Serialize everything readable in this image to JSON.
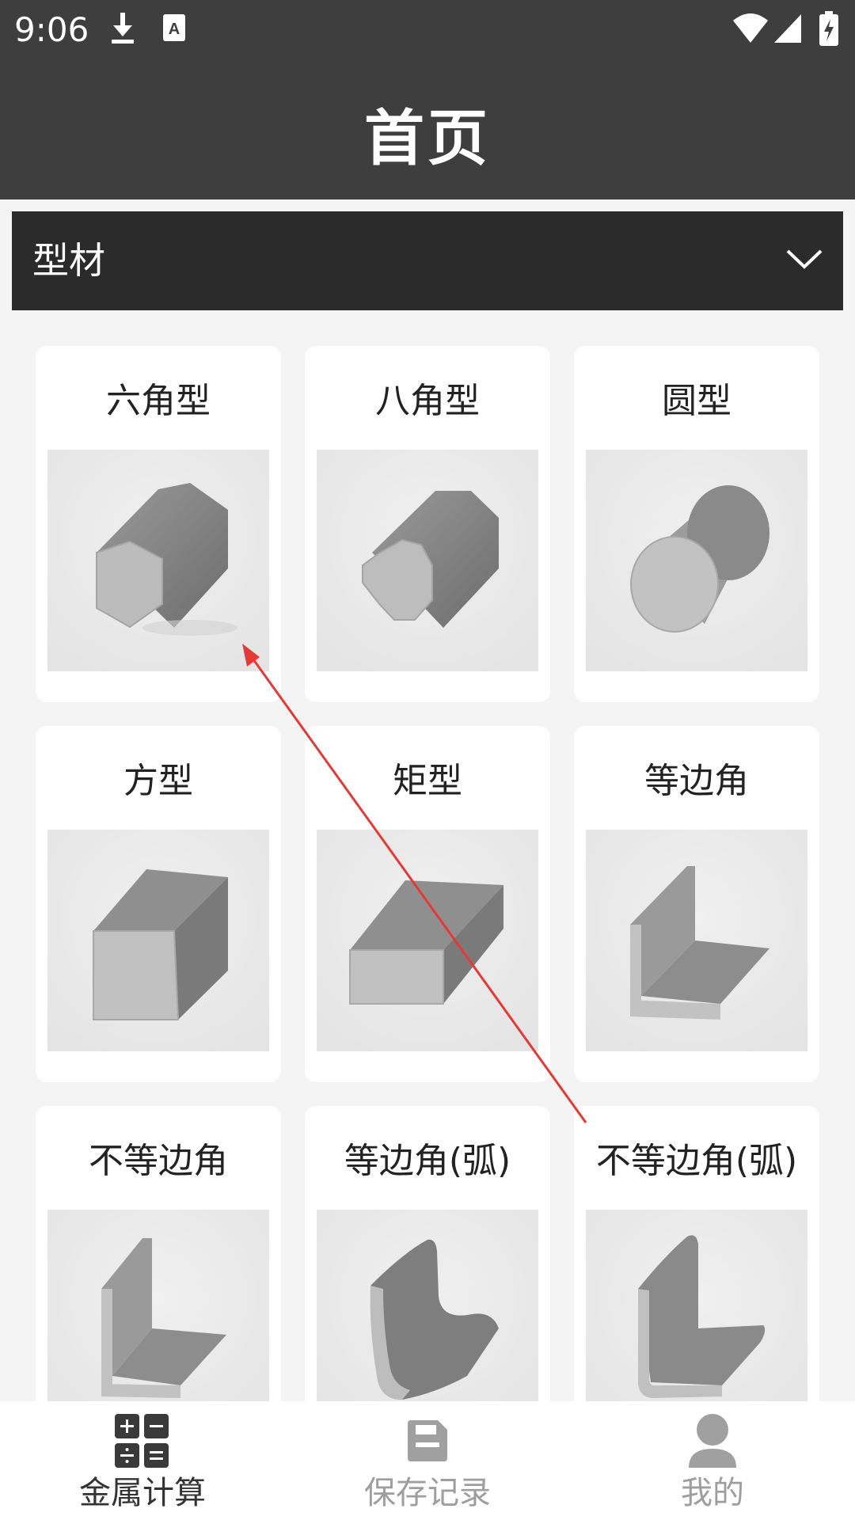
{
  "status_bar": {
    "time": "9:06",
    "icons": [
      "download-icon",
      "keyboard-a-icon",
      "wifi-icon",
      "signal-icon",
      "battery-icon"
    ]
  },
  "header": {
    "title": "首页"
  },
  "category": {
    "selected": "型材",
    "icon": "chevron-down-icon"
  },
  "grid": {
    "items": [
      {
        "label": "六角型",
        "icon": "hexagon-bar-icon"
      },
      {
        "label": "八角型",
        "icon": "octagon-bar-icon"
      },
      {
        "label": "圆型",
        "icon": "round-bar-icon"
      },
      {
        "label": "方型",
        "icon": "square-bar-icon"
      },
      {
        "label": "矩型",
        "icon": "rectangle-bar-icon"
      },
      {
        "label": "等边角",
        "icon": "equal-angle-icon"
      },
      {
        "label": "不等边角",
        "icon": "unequal-angle-icon"
      },
      {
        "label": "等边角(弧)",
        "icon": "equal-angle-arc-icon"
      },
      {
        "label": "不等边角(弧)",
        "icon": "unequal-angle-arc-icon"
      }
    ]
  },
  "bottom_nav": {
    "items": [
      {
        "label": "金属计算",
        "icon": "calculator-icon",
        "active": true
      },
      {
        "label": "保存记录",
        "icon": "save-icon",
        "active": false
      },
      {
        "label": "我的",
        "icon": "user-icon",
        "active": false
      }
    ]
  },
  "colors": {
    "header_bg": "#3e3e3e",
    "category_bg": "#2b2b2b",
    "page_bg": "#f4f4f4",
    "annotation_arrow": "#e53935"
  }
}
